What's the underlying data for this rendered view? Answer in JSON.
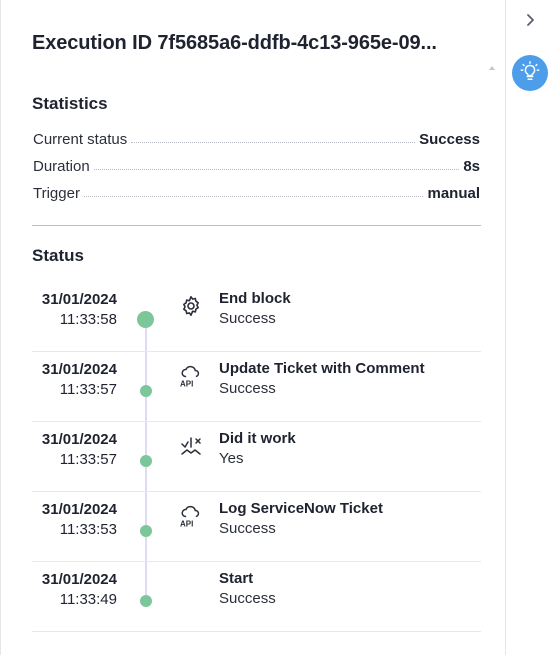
{
  "header": {
    "title": "Execution ID 7f5685a6-ddfb-4c13-965e-09...",
    "collapse_icon": "chevron-right-icon",
    "idea_icon": "lightbulb-icon",
    "accent_color": "#4c9dea"
  },
  "statistics": {
    "heading": "Statistics",
    "rows": [
      {
        "label": "Current status",
        "value": "Success"
      },
      {
        "label": "Duration",
        "value": "8s"
      },
      {
        "label": "Trigger",
        "value": "manual"
      }
    ]
  },
  "status": {
    "heading": "Status",
    "dot_color": "#7cc79a",
    "events": [
      {
        "date": "31/01/2024",
        "time": "11:33:58",
        "name": "End block",
        "status": "Success",
        "icon": "gear-icon"
      },
      {
        "date": "31/01/2024",
        "time": "11:33:57",
        "name": "Update Ticket with Comment",
        "status": "Success",
        "icon": "cloud-api-icon"
      },
      {
        "date": "31/01/2024",
        "time": "11:33:57",
        "name": "Did it work",
        "status": "Yes",
        "icon": "branch-condition-icon"
      },
      {
        "date": "31/01/2024",
        "time": "11:33:53",
        "name": "Log ServiceNow Ticket",
        "status": "Success",
        "icon": "cloud-api-icon"
      },
      {
        "date": "31/01/2024",
        "time": "11:33:49",
        "name": "Start",
        "status": "Success",
        "icon": ""
      }
    ]
  }
}
